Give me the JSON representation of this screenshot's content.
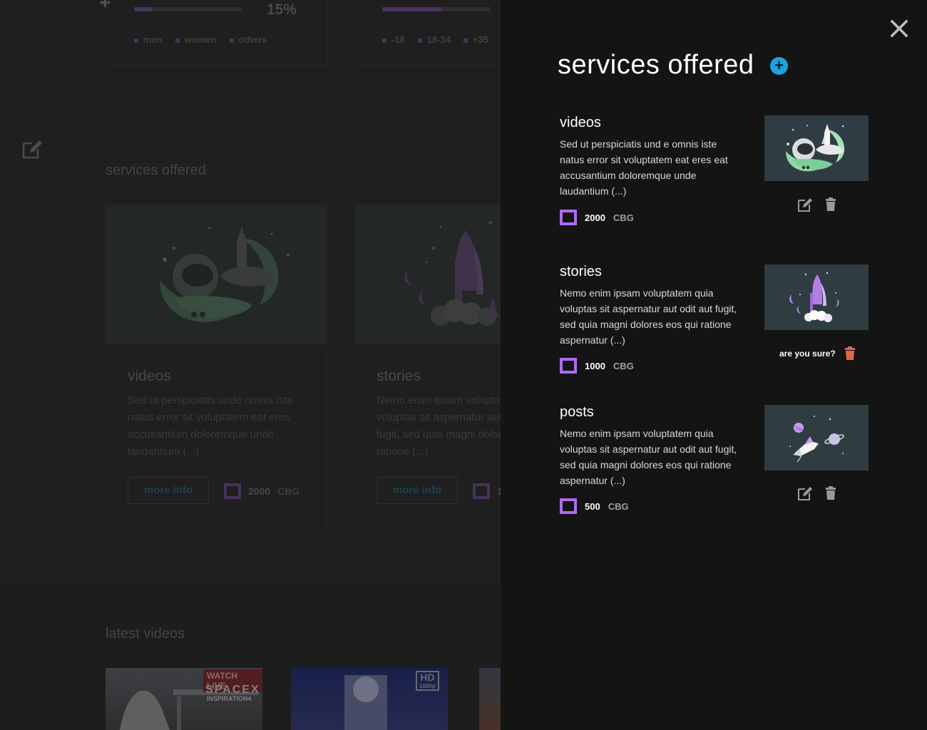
{
  "background": {
    "stats": [
      {
        "percent": "15%",
        "progress": 0.17,
        "legend": [
          "men",
          "women",
          "others"
        ]
      },
      {
        "percent": "",
        "progress": 0.55,
        "legend": [
          "-18",
          "18-34",
          "+35"
        ]
      }
    ],
    "services_title": "services offered",
    "services": [
      {
        "title": "videos",
        "description": "Sed ut perspiciatis unde omnis iste natus error sit voluptatem eat eres accusantium doloremque unde laudantium (...)",
        "more_label": "more info",
        "price": "2000",
        "unit": "CBG"
      },
      {
        "title": "stories",
        "description": "Nemo enim ipsam voluptatem quia voluptas sit aspernatur aut odit aut fugit, sed quia magni dolores eos qui ratione (...)",
        "more_label": "more info",
        "price": "1",
        "unit": ""
      }
    ],
    "latest_title": "latest videos",
    "videos": [
      {
        "badge": "WATCH LIVE",
        "brand": "SPACEX",
        "subtitle": "INSPIRATION4"
      },
      {
        "badge": "HD",
        "subtitle": "1080p"
      },
      {}
    ]
  },
  "panel": {
    "title": "services offered",
    "add_label": "+",
    "services": [
      {
        "title": "videos",
        "description": "Sed ut perspiciatis und e omnis iste natus error sit voluptatem eat eres eat accusantium doloremque unde laudantium (...)",
        "price": "2000",
        "unit": "CBG"
      },
      {
        "title": "stories",
        "description": "Nemo enim ipsam voluptatem quia voluptas sit aspernatur aut odit aut fugit, sed quia magni dolores eos qui ratione aspernatur (...)",
        "price": "1000",
        "unit": "CBG",
        "confirm_label": "are you sure?"
      },
      {
        "title": "posts",
        "description": "Nemo enim ipsam voluptatem quia voluptas sit aspernatur aut odit aut fugit, sed quia magni dolores eos qui ratione aspernatur (...)",
        "price": "500",
        "unit": "CBG"
      }
    ]
  },
  "colors": {
    "accent_purple": "#ad6cf0",
    "accent_blue": "#1aa3df",
    "danger": "#e2644f",
    "panel_bg": "#141414",
    "thumb_bg": "#2f3d43"
  },
  "icons": [
    "close-icon",
    "plus-icon",
    "edit-icon",
    "trash-icon",
    "checkbox-icon"
  ]
}
